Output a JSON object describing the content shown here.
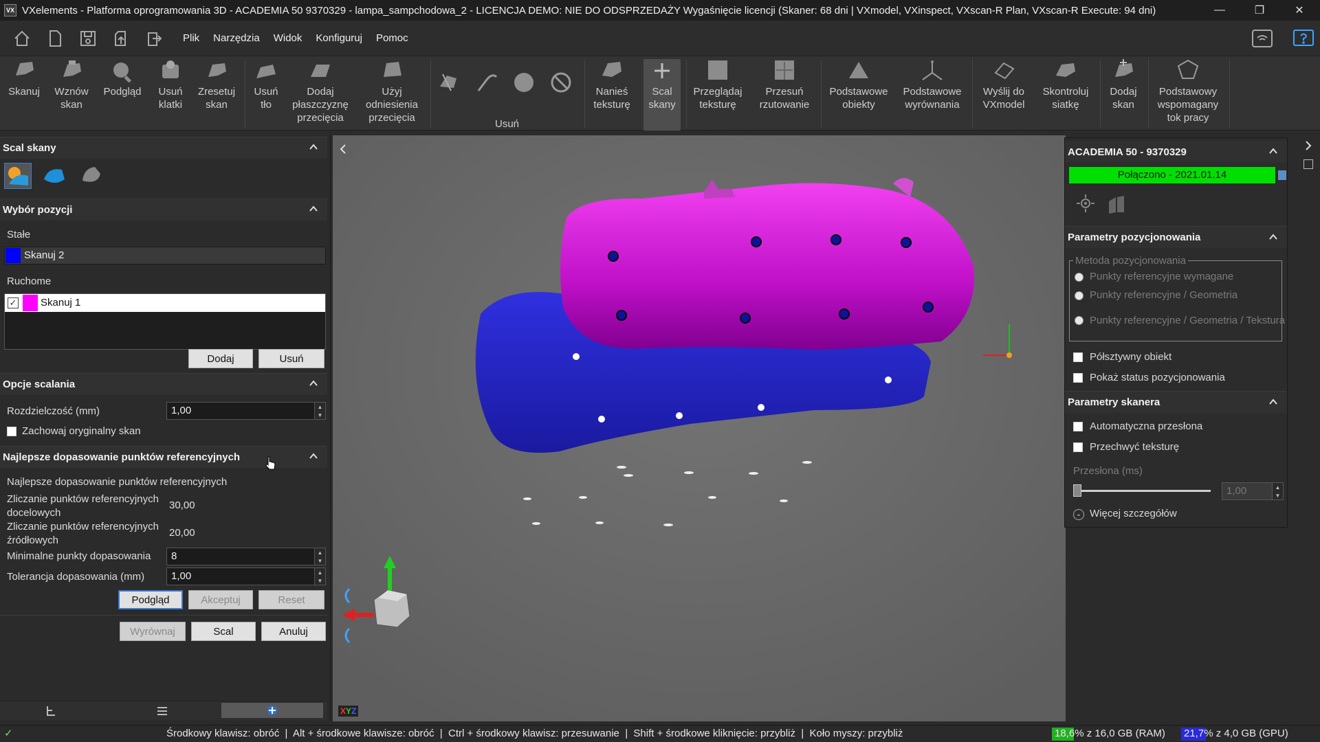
{
  "window": {
    "title": "VXelements - Platforma oprogramowania 3D - ACADEMIA 50 9370329 - lampa_sampchodowa_2 - LICENCJA DEMO: NIE DO ODSPRZEDAŻY Wygaśnięcie licencji (Skaner: 68 dni | VXmodel, VXinspect, VXscan-R Plan, VXscan-R Execute: 94 dni)",
    "logo": "VX"
  },
  "menu": [
    "Plik",
    "Narzędzia",
    "Widok",
    "Konfiguruj",
    "Pomoc"
  ],
  "quick_icons": [
    "home-icon",
    "new-file-icon",
    "save-icon",
    "import-icon",
    "export-icon"
  ],
  "ribbon": {
    "skanuj": "Skanuj",
    "wznow": [
      "Wznów",
      "skan"
    ],
    "podglad": "Podgląd",
    "usun_klatki": [
      "Usuń",
      "klatki"
    ],
    "zresetuj": [
      "Zresetuj",
      "skan"
    ],
    "usun_tlo": [
      "Usuń",
      "tło"
    ],
    "dodaj_plaszczyzne": [
      "Dodaj",
      "płaszczyznę",
      "przecięcia"
    ],
    "uzyj_odniesienia": [
      "Użyj",
      "odniesienia",
      "przecięcia"
    ],
    "usun_group": "Usuń",
    "nanies_teksture": [
      "Nanieś",
      "teksturę"
    ],
    "scal_skany": [
      "Scal",
      "skany"
    ],
    "przegladaj_teksture": [
      "Przeglądaj",
      "teksturę"
    ],
    "przesun_rzutowanie": [
      "Przesuń",
      "rzutowanie"
    ],
    "podstawowe_obiekty": [
      "Podstawowe",
      "obiekty"
    ],
    "podstawowe_wyrownania": [
      "Podstawowe",
      "wyrównania"
    ],
    "wyslij": [
      "Wyślij do",
      "VXmodel"
    ],
    "skontroluj": [
      "Skontroluj",
      "siatkę"
    ],
    "dodaj_skan": [
      "Dodaj",
      "skan"
    ],
    "podstawowy_tok": [
      "Podstawowy",
      "wspomagany",
      "tok pracy"
    ]
  },
  "left": {
    "scal_title": "Scal skany",
    "wybor_title": "Wybór pozycji",
    "stale_label": "Stałe",
    "stale_item": "Skanuj 2",
    "stale_color": "#0000ff",
    "ruchome_label": "Ruchome",
    "ruchome_item": "Skanuj 1",
    "ruchome_color": "#ff00ff",
    "dodaj": "Dodaj",
    "usun": "Usuń",
    "opcje_title": "Opcje scalania",
    "rozdzielczosc_label": "Rozdzielczość (mm)",
    "rozdzielczosc_value": "1,00",
    "zachowaj_label": "Zachowaj oryginalny skan",
    "najlepsze_title": "Najlepsze dopasowanie punktów referencyjnych",
    "najlepsze_sub": "Najlepsze dopasowanie punktów referencyjnych",
    "docelowych_label": [
      "Zliczanie punktów referencyjnych",
      "docelowych"
    ],
    "docelowych_value": "30,00",
    "zrodlowych_label": [
      "Zliczanie punktów referencyjnych",
      "źródłowych"
    ],
    "zrodlowych_value": "20,00",
    "min_label": "Minimalne punkty dopasowania",
    "min_value": "8",
    "tol_label": "Tolerancja dopasowania (mm)",
    "tol_value": "1,00",
    "podglad": "Podgląd",
    "akceptuj": "Akceptuj",
    "reset": "Reset",
    "wyrownaj": "Wyrównaj",
    "scal": "Scal",
    "anuluj": "Anuluj"
  },
  "right": {
    "device_title": "ACADEMIA 50 - 9370329",
    "connected": "Połączono - 2021.01.14",
    "connected_color": "#00e000",
    "pos_title": "Parametry pozycjonowania",
    "metoda_label": "Metoda pozycjonowania",
    "metoda_opts": [
      "Punkty referencyjne wymagane",
      "Punkty referencyjne / Geometria",
      "Punkty referencyjne / Geometria / Tekstura"
    ],
    "polsztywny": "Półsztywny obiekt",
    "pokaz_status": "Pokaż status pozycjonowania",
    "skaner_title": "Parametry skanera",
    "auto_przeslona": "Automatyczna przesłona",
    "przechwyc": "Przechwyć teksturę",
    "przeslona_label": "Przesłona (ms)",
    "przeslona_value": "1,00",
    "wiecej": "Więcej szczegółów"
  },
  "viewport": {
    "axis_label": [
      "X",
      "Y",
      "Z"
    ],
    "axis_colors": [
      "#ff3030",
      "#30d030",
      "#4060ff"
    ]
  },
  "status": {
    "hints": "Środkowy klawisz: obróć  |  Alt + środkowe klawisze: obróć  |  Ctrl + środkowy klawisz: przesuwanie  |  Shift + środkowe kliknięcie: przybliż  |  Koło myszy: przybliż",
    "ram_pct": "18,6%",
    "ram_rest": " z 16,0 GB (RAM)",
    "gpu_pct": "21,7%",
    "gpu_rest": " z 4,0 GB (GPU)",
    "ram_fraction": 0.186,
    "gpu_fraction": 0.217
  }
}
